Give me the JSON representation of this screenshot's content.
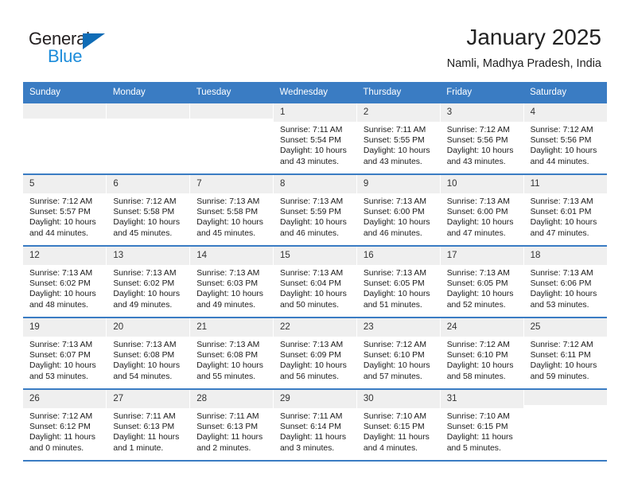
{
  "brand": {
    "name_part1": "General",
    "name_part2": "Blue",
    "logo_icon": "triangle-logo-icon"
  },
  "header": {
    "title": "January 2025",
    "subtitle": "Namli, Madhya Pradesh, India"
  },
  "calendar": {
    "weekday_headers": [
      "Sunday",
      "Monday",
      "Tuesday",
      "Wednesday",
      "Thursday",
      "Friday",
      "Saturday"
    ],
    "accent_color": "#3a7cc3",
    "daynum_background": "#efefef",
    "weeks": [
      [
        {
          "day": "",
          "empty": true
        },
        {
          "day": "",
          "empty": true
        },
        {
          "day": "",
          "empty": true
        },
        {
          "day": "1",
          "sunrise": "Sunrise: 7:11 AM",
          "sunset": "Sunset: 5:54 PM",
          "daylight": "Daylight: 10 hours and 43 minutes."
        },
        {
          "day": "2",
          "sunrise": "Sunrise: 7:11 AM",
          "sunset": "Sunset: 5:55 PM",
          "daylight": "Daylight: 10 hours and 43 minutes."
        },
        {
          "day": "3",
          "sunrise": "Sunrise: 7:12 AM",
          "sunset": "Sunset: 5:56 PM",
          "daylight": "Daylight: 10 hours and 43 minutes."
        },
        {
          "day": "4",
          "sunrise": "Sunrise: 7:12 AM",
          "sunset": "Sunset: 5:56 PM",
          "daylight": "Daylight: 10 hours and 44 minutes."
        }
      ],
      [
        {
          "day": "5",
          "sunrise": "Sunrise: 7:12 AM",
          "sunset": "Sunset: 5:57 PM",
          "daylight": "Daylight: 10 hours and 44 minutes."
        },
        {
          "day": "6",
          "sunrise": "Sunrise: 7:12 AM",
          "sunset": "Sunset: 5:58 PM",
          "daylight": "Daylight: 10 hours and 45 minutes."
        },
        {
          "day": "7",
          "sunrise": "Sunrise: 7:13 AM",
          "sunset": "Sunset: 5:58 PM",
          "daylight": "Daylight: 10 hours and 45 minutes."
        },
        {
          "day": "8",
          "sunrise": "Sunrise: 7:13 AM",
          "sunset": "Sunset: 5:59 PM",
          "daylight": "Daylight: 10 hours and 46 minutes."
        },
        {
          "day": "9",
          "sunrise": "Sunrise: 7:13 AM",
          "sunset": "Sunset: 6:00 PM",
          "daylight": "Daylight: 10 hours and 46 minutes."
        },
        {
          "day": "10",
          "sunrise": "Sunrise: 7:13 AM",
          "sunset": "Sunset: 6:00 PM",
          "daylight": "Daylight: 10 hours and 47 minutes."
        },
        {
          "day": "11",
          "sunrise": "Sunrise: 7:13 AM",
          "sunset": "Sunset: 6:01 PM",
          "daylight": "Daylight: 10 hours and 47 minutes."
        }
      ],
      [
        {
          "day": "12",
          "sunrise": "Sunrise: 7:13 AM",
          "sunset": "Sunset: 6:02 PM",
          "daylight": "Daylight: 10 hours and 48 minutes."
        },
        {
          "day": "13",
          "sunrise": "Sunrise: 7:13 AM",
          "sunset": "Sunset: 6:02 PM",
          "daylight": "Daylight: 10 hours and 49 minutes."
        },
        {
          "day": "14",
          "sunrise": "Sunrise: 7:13 AM",
          "sunset": "Sunset: 6:03 PM",
          "daylight": "Daylight: 10 hours and 49 minutes."
        },
        {
          "day": "15",
          "sunrise": "Sunrise: 7:13 AM",
          "sunset": "Sunset: 6:04 PM",
          "daylight": "Daylight: 10 hours and 50 minutes."
        },
        {
          "day": "16",
          "sunrise": "Sunrise: 7:13 AM",
          "sunset": "Sunset: 6:05 PM",
          "daylight": "Daylight: 10 hours and 51 minutes."
        },
        {
          "day": "17",
          "sunrise": "Sunrise: 7:13 AM",
          "sunset": "Sunset: 6:05 PM",
          "daylight": "Daylight: 10 hours and 52 minutes."
        },
        {
          "day": "18",
          "sunrise": "Sunrise: 7:13 AM",
          "sunset": "Sunset: 6:06 PM",
          "daylight": "Daylight: 10 hours and 53 minutes."
        }
      ],
      [
        {
          "day": "19",
          "sunrise": "Sunrise: 7:13 AM",
          "sunset": "Sunset: 6:07 PM",
          "daylight": "Daylight: 10 hours and 53 minutes."
        },
        {
          "day": "20",
          "sunrise": "Sunrise: 7:13 AM",
          "sunset": "Sunset: 6:08 PM",
          "daylight": "Daylight: 10 hours and 54 minutes."
        },
        {
          "day": "21",
          "sunrise": "Sunrise: 7:13 AM",
          "sunset": "Sunset: 6:08 PM",
          "daylight": "Daylight: 10 hours and 55 minutes."
        },
        {
          "day": "22",
          "sunrise": "Sunrise: 7:13 AM",
          "sunset": "Sunset: 6:09 PM",
          "daylight": "Daylight: 10 hours and 56 minutes."
        },
        {
          "day": "23",
          "sunrise": "Sunrise: 7:12 AM",
          "sunset": "Sunset: 6:10 PM",
          "daylight": "Daylight: 10 hours and 57 minutes."
        },
        {
          "day": "24",
          "sunrise": "Sunrise: 7:12 AM",
          "sunset": "Sunset: 6:10 PM",
          "daylight": "Daylight: 10 hours and 58 minutes."
        },
        {
          "day": "25",
          "sunrise": "Sunrise: 7:12 AM",
          "sunset": "Sunset: 6:11 PM",
          "daylight": "Daylight: 10 hours and 59 minutes."
        }
      ],
      [
        {
          "day": "26",
          "sunrise": "Sunrise: 7:12 AM",
          "sunset": "Sunset: 6:12 PM",
          "daylight": "Daylight: 11 hours and 0 minutes."
        },
        {
          "day": "27",
          "sunrise": "Sunrise: 7:11 AM",
          "sunset": "Sunset: 6:13 PM",
          "daylight": "Daylight: 11 hours and 1 minute."
        },
        {
          "day": "28",
          "sunrise": "Sunrise: 7:11 AM",
          "sunset": "Sunset: 6:13 PM",
          "daylight": "Daylight: 11 hours and 2 minutes."
        },
        {
          "day": "29",
          "sunrise": "Sunrise: 7:11 AM",
          "sunset": "Sunset: 6:14 PM",
          "daylight": "Daylight: 11 hours and 3 minutes."
        },
        {
          "day": "30",
          "sunrise": "Sunrise: 7:10 AM",
          "sunset": "Sunset: 6:15 PM",
          "daylight": "Daylight: 11 hours and 4 minutes."
        },
        {
          "day": "31",
          "sunrise": "Sunrise: 7:10 AM",
          "sunset": "Sunset: 6:15 PM",
          "daylight": "Daylight: 11 hours and 5 minutes."
        },
        {
          "day": "",
          "empty": true
        }
      ]
    ]
  }
}
